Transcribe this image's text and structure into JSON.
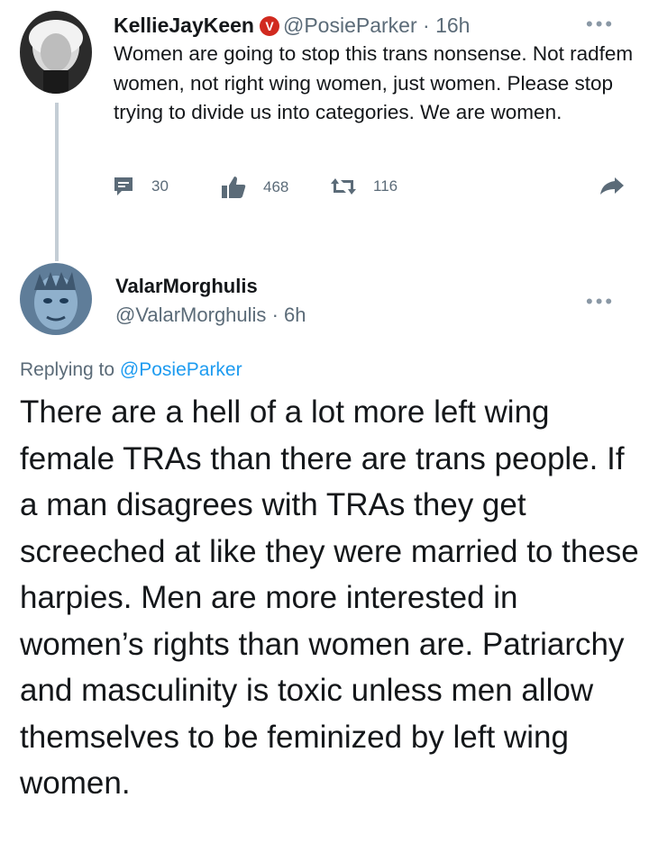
{
  "tweet1": {
    "display_name": "KellieJayKeen",
    "badge_letter": "V",
    "handle": "@PosieParker",
    "separator": "·",
    "time": "16h",
    "text": "Women are going to stop this trans nonsense.  Not radfem women, not right wing women, just women. Please stop trying to divide us into categories.  We are women.",
    "actions": {
      "replies": "30",
      "likes": "468",
      "retweets": "116"
    }
  },
  "tweet2": {
    "display_name": "ValarMorghulis",
    "handle": "@ValarMorghulis",
    "separator": "·",
    "time": "6h",
    "replying_prefix": "Replying to ",
    "replying_to": "@PosieParker",
    "text": "There are a hell of a lot more left wing female TRAs than there are trans people. If a man disagrees with TRAs they get screeched at like they were married to these harpies. Men are more interested in women’s rights than women are. Patriarchy and masculinity is toxic unless men allow themselves to be feminized by left wing women."
  },
  "more_glyph": "•••",
  "colors": {
    "accent": "#1d9bf0",
    "muted": "#5b6b78",
    "badge": "#d12a1f",
    "thread_line": "#c4cdd5"
  },
  "icons": [
    "reply-icon",
    "like-icon",
    "retweet-icon",
    "share-icon",
    "more-icon",
    "verified-badge"
  ]
}
